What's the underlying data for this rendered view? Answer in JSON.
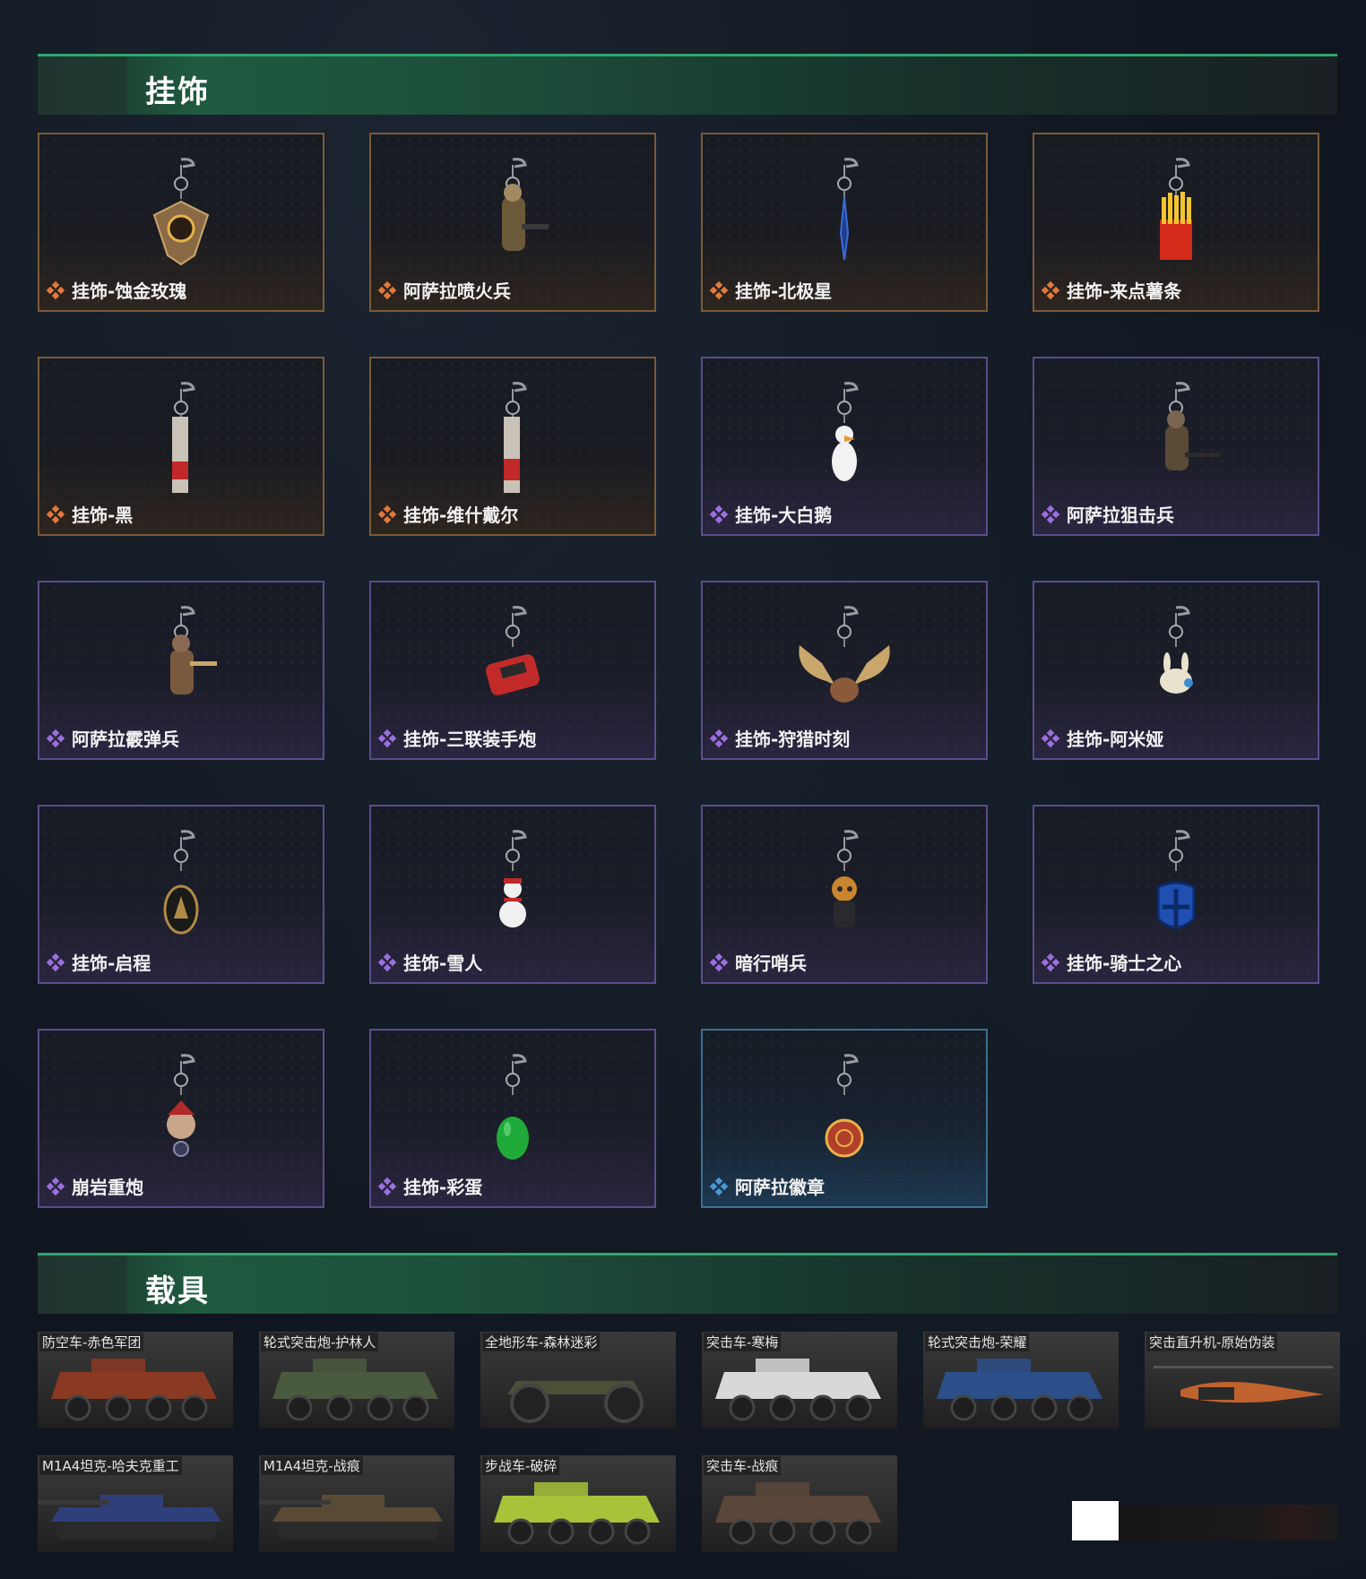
{
  "sections": {
    "charms": {
      "title": "挂饰"
    },
    "vehicles": {
      "title": "载具"
    }
  },
  "colors": {
    "orange_rarity": "#e07a3a",
    "purple_rarity": "#9b6fe0",
    "blue_rarity": "#4a9ad6",
    "header_green": "#2fa56e"
  },
  "charms": [
    {
      "label": "挂饰-蚀金玫瑰",
      "rarity": "orange",
      "icon": "rose-medallion-charm-icon"
    },
    {
      "label": "阿萨拉喷火兵",
      "rarity": "orange",
      "icon": "flamethrower-soldier-charm-icon"
    },
    {
      "label": "挂饰-北极星",
      "rarity": "orange",
      "icon": "polaris-charm-icon"
    },
    {
      "label": "挂饰-来点薯条",
      "rarity": "orange",
      "icon": "fries-charm-icon"
    },
    {
      "label": "挂饰-黑",
      "rarity": "orange",
      "icon": "black-tag-charm-icon"
    },
    {
      "label": "挂饰-维什戴尔",
      "rarity": "orange",
      "icon": "wisadel-tag-charm-icon"
    },
    {
      "label": "挂饰-大白鹅",
      "rarity": "purple",
      "icon": "white-goose-charm-icon"
    },
    {
      "label": "阿萨拉狙击兵",
      "rarity": "purple",
      "icon": "sniper-soldier-charm-icon"
    },
    {
      "label": "阿萨拉霰弹兵",
      "rarity": "purple",
      "icon": "shotgun-soldier-charm-icon"
    },
    {
      "label": "挂饰-三联装手炮",
      "rarity": "purple",
      "icon": "triple-hand-cannon-charm-icon"
    },
    {
      "label": "挂饰-狩猎时刻",
      "rarity": "purple",
      "icon": "moose-antlers-charm-icon"
    },
    {
      "label": "挂饰-阿米娅",
      "rarity": "purple",
      "icon": "amiya-bunny-charm-icon"
    },
    {
      "label": "挂饰-启程",
      "rarity": "purple",
      "icon": "departure-coin-charm-icon"
    },
    {
      "label": "挂饰-雪人",
      "rarity": "purple",
      "icon": "snowman-charm-icon"
    },
    {
      "label": "暗行哨兵",
      "rarity": "purple",
      "icon": "shadow-sentinel-charm-icon"
    },
    {
      "label": "挂饰-骑士之心",
      "rarity": "purple",
      "icon": "knight-heart-charm-icon"
    },
    {
      "label": "崩岩重炮",
      "rarity": "purple",
      "icon": "rock-cannon-charm-icon"
    },
    {
      "label": "挂饰-彩蛋",
      "rarity": "purple",
      "icon": "easter-egg-charm-icon"
    },
    {
      "label": "阿萨拉徽章",
      "rarity": "blue",
      "icon": "asara-badge-charm-icon"
    }
  ],
  "vehicles": [
    {
      "label": "防空车-赤色军团",
      "icon": "anti-air-vehicle-icon",
      "tint": "#8a3a22"
    },
    {
      "label": "轮式突击炮-护林人",
      "icon": "wheeled-assault-gun-icon",
      "tint": "#4a5a3e"
    },
    {
      "label": "全地形车-森林迷彩",
      "icon": "atv-icon",
      "tint": "#4b5036"
    },
    {
      "label": "突击车-寒梅",
      "icon": "assault-vehicle-icon",
      "tint": "#d8d8d8"
    },
    {
      "label": "轮式突击炮-荣耀",
      "icon": "wheeled-assault-gun-icon",
      "tint": "#2c4f8a"
    },
    {
      "label": "突击直升机-原始伪装",
      "icon": "attack-helicopter-icon",
      "tint": "#c0622e"
    },
    {
      "label": "M1A4坦克-哈夫克重工",
      "icon": "tank-icon",
      "tint": "#2e3f7a"
    },
    {
      "label": "M1A4坦克-战痕",
      "icon": "tank-icon",
      "tint": "#5a4a35"
    },
    {
      "label": "步战车-破碎",
      "icon": "ifv-icon",
      "tint": "#a8c23a"
    },
    {
      "label": "突击车-战痕",
      "icon": "assault-vehicle-icon",
      "tint": "#5a463a"
    }
  ]
}
